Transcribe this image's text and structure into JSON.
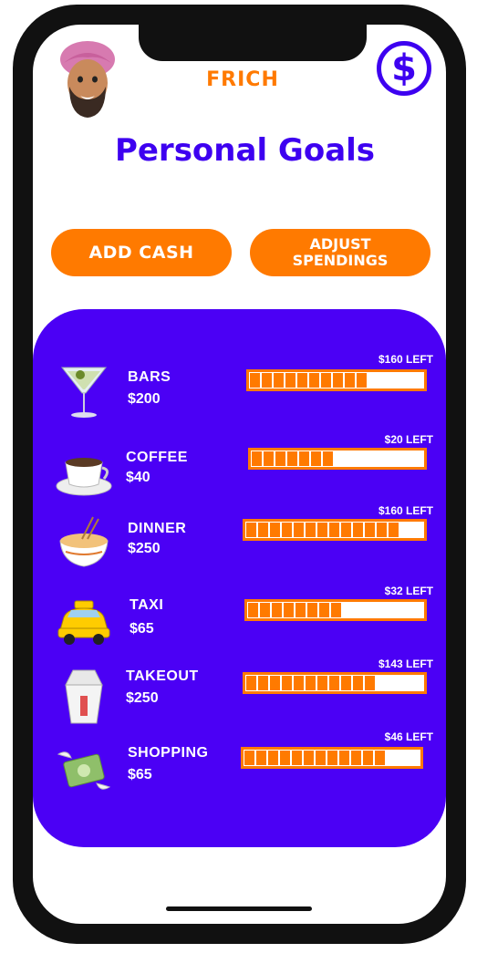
{
  "app": {
    "brand": "FRICH",
    "title": "Personal Goals"
  },
  "actions": {
    "add_cash": "ADD CASH",
    "adjust_line1": "ADJUST",
    "adjust_line2": "SPENDINGS"
  },
  "icons": {
    "avatar": "avatar-icon",
    "currency": "dollar-icon"
  },
  "colors": {
    "accent": "#ff7a00",
    "primary": "#3d00f0",
    "panel": "#4b00f5"
  },
  "goals": [
    {
      "name": "BARS",
      "amount": "$200",
      "left": "$160 LEFT",
      "progress": 0.72,
      "icon": "cocktail-icon"
    },
    {
      "name": "COFFEE",
      "amount": "$40",
      "left": "$20 LEFT",
      "progress": 0.5,
      "icon": "coffee-cup-icon"
    },
    {
      "name": "DINNER",
      "amount": "$250",
      "left": "$160 LEFT",
      "progress": 0.88,
      "icon": "noodle-bowl-icon"
    },
    {
      "name": "TAXI",
      "amount": "$65",
      "left": "$32 LEFT",
      "progress": 0.51,
      "icon": "taxi-icon"
    },
    {
      "name": "TAKEOUT",
      "amount": "$250",
      "left": "$143 LEFT",
      "progress": 0.73,
      "icon": "takeout-box-icon"
    },
    {
      "name": "SHOPPING",
      "amount": "$65",
      "left": "$46 LEFT",
      "progress": 0.82,
      "icon": "flying-money-icon"
    }
  ]
}
